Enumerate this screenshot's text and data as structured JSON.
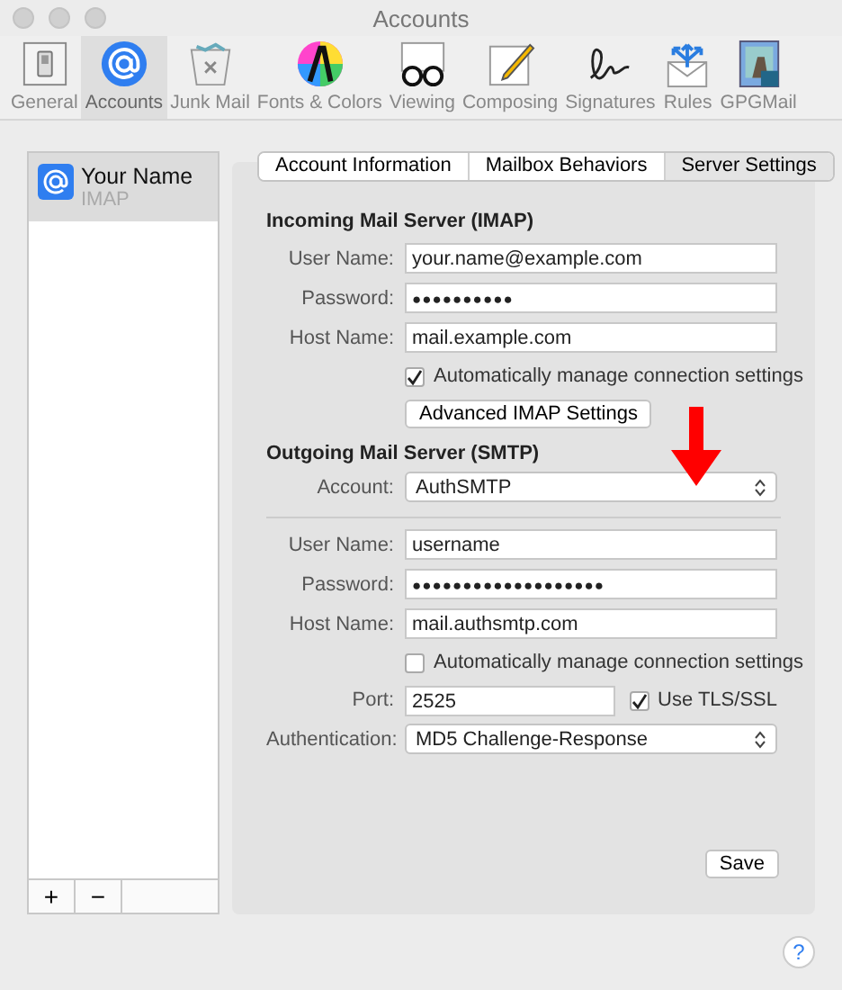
{
  "window": {
    "title": "Accounts"
  },
  "toolbar": [
    {
      "label": "General",
      "kind": "general",
      "selected": false
    },
    {
      "label": "Accounts",
      "kind": "accounts",
      "selected": true
    },
    {
      "label": "Junk Mail",
      "kind": "junk",
      "selected": false
    },
    {
      "label": "Fonts & Colors",
      "kind": "fonts",
      "selected": false
    },
    {
      "label": "Viewing",
      "kind": "viewing",
      "selected": false
    },
    {
      "label": "Composing",
      "kind": "composing",
      "selected": false
    },
    {
      "label": "Signatures",
      "kind": "signatures",
      "selected": false
    },
    {
      "label": "Rules",
      "kind": "rules",
      "selected": false
    },
    {
      "label": "GPGMail",
      "kind": "gpgmail",
      "selected": false
    }
  ],
  "accounts": [
    {
      "name": "Your Name",
      "type": "IMAP",
      "selected": true
    }
  ],
  "list_buttons": [
    "+",
    "−"
  ],
  "tabs": [
    {
      "label": "Account Information",
      "selected": false
    },
    {
      "label": "Mailbox Behaviors",
      "selected": false
    },
    {
      "label": "Server Settings",
      "selected": true
    }
  ],
  "incoming": {
    "heading": "Incoming Mail Server (IMAP)",
    "fields": [
      {
        "label": "User Name:",
        "value": "your.name@example.com",
        "kind": "text"
      },
      {
        "label": "Password:",
        "value": "●●●●●●●●●●",
        "kind": "password"
      },
      {
        "label": "Host Name:",
        "value": "mail.example.com",
        "kind": "text"
      }
    ],
    "auto_manage": {
      "label": "Automatically manage connection settings",
      "checked": true
    },
    "advanced_button": "Advanced IMAP Settings"
  },
  "outgoing": {
    "heading": "Outgoing Mail Server (SMTP)",
    "account": {
      "label": "Account:",
      "value": "AuthSMTP"
    },
    "fields": [
      {
        "label": "User Name:",
        "value": "username",
        "kind": "text"
      },
      {
        "label": "Password:",
        "value": "●●●●●●●●●●●●●●●●●●●",
        "kind": "password"
      },
      {
        "label": "Host Name:",
        "value": "mail.authsmtp.com",
        "kind": "text"
      }
    ],
    "auto_manage": {
      "label": "Automatically manage connection settings",
      "checked": false
    },
    "port": {
      "label": "Port:",
      "value": "2525"
    },
    "tls": {
      "label": "Use TLS/SSL",
      "checked": true
    },
    "authentication": {
      "label": "Authentication:",
      "value": "MD5 Challenge-Response"
    }
  },
  "save_button": "Save",
  "help_button": "?"
}
